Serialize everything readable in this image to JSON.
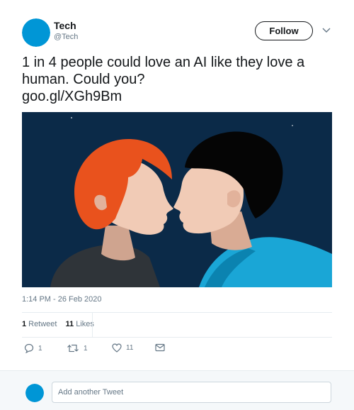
{
  "colors": {
    "brand_blue": "#0096d6",
    "text_primary": "#14171a",
    "text_secondary": "#657786",
    "divider": "#e6ecf0",
    "image_background": "#0b2a48",
    "red_hair": "#e9521d",
    "shirt_cyan": "#1aa6d6"
  },
  "author": {
    "display_name": "Tech",
    "handle": "@Tech",
    "follow_label": "Follow",
    "avatar_icon": "circle-avatar",
    "menu_icon": "chevron-down-icon"
  },
  "tweet": {
    "text": "1 in 4 people could love an AI like they love a human. Could you?",
    "link": "goo.gl/XGh9Bm",
    "media_alt": "illustration-two-faces-kissing",
    "timestamp": "1:14 PM - 26 Feb 2020"
  },
  "stats": {
    "retweets_count": "1",
    "retweets_label": "Retweet",
    "likes_count": "11",
    "likes_label": "Likes"
  },
  "actions": {
    "reply_count": "1",
    "retweet_count": "1",
    "like_count": "11",
    "reply_icon": "reply-icon",
    "retweet_icon": "retweet-icon",
    "like_icon": "heart-icon",
    "dm_icon": "envelope-icon"
  },
  "reply_bar": {
    "placeholder": "Add another Tweet"
  }
}
